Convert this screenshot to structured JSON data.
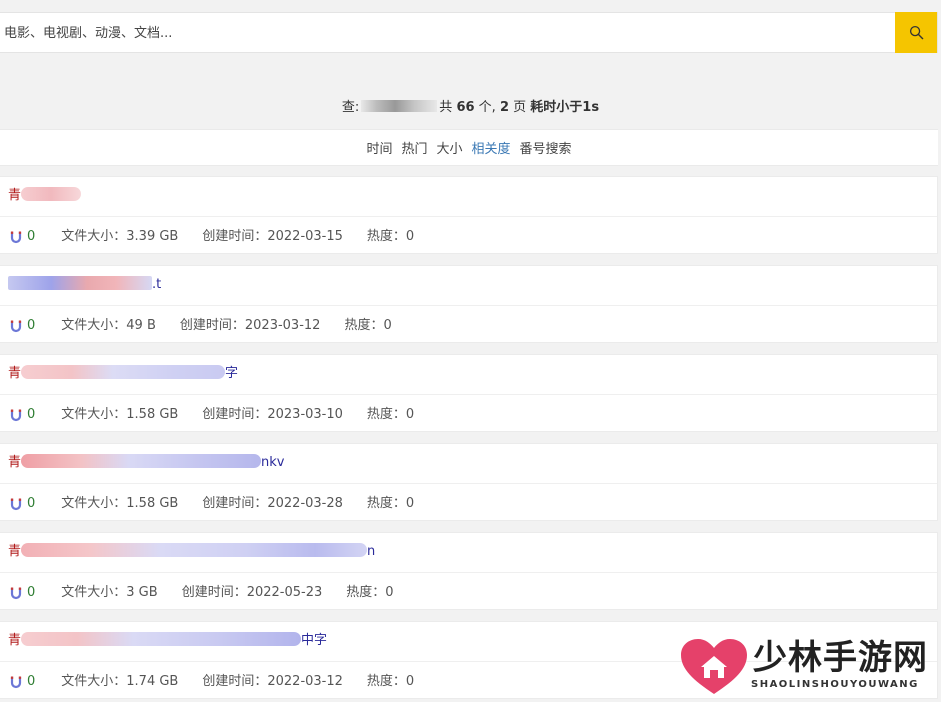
{
  "search": {
    "placeholder": "电影、电视剧、动漫、文档..."
  },
  "summary": {
    "prefix": "查:",
    "middle": "共",
    "count": "66",
    "count_unit": "个,",
    "pages": "2",
    "pages_unit": "页",
    "time_text": "耗时小于1s"
  },
  "sort": {
    "items": [
      "时间",
      "热门",
      "大小",
      "相关度",
      "番号搜索"
    ],
    "active_index": 3
  },
  "results": [
    {
      "title_start": "青",
      "title_end": "",
      "magnet": "0",
      "size": "文件大小：3.39 GB",
      "created": "创建时间：2022-03-15",
      "hot": "热度：0"
    },
    {
      "title_start": "",
      "title_end": ".t",
      "magnet": "0",
      "size": "文件大小：49 B",
      "created": "创建时间：2023-03-12",
      "hot": "热度：0"
    },
    {
      "title_start": "青",
      "title_end": "字",
      "magnet": "0",
      "size": "文件大小：1.58 GB",
      "created": "创建时间：2023-03-10",
      "hot": "热度：0"
    },
    {
      "title_start": "青",
      "title_end": "nkv",
      "magnet": "0",
      "size": "文件大小：1.58 GB",
      "created": "创建时间：2022-03-28",
      "hot": "热度：0"
    },
    {
      "title_start": "青",
      "title_end": "n",
      "magnet": "0",
      "size": "文件大小：3 GB",
      "created": "创建时间：2022-05-23",
      "hot": "热度：0"
    },
    {
      "title_start": "青",
      "title_end": "中字",
      "magnet": "0",
      "size": "文件大小：1.74 GB",
      "created": "创建时间：2022-03-12",
      "hot": "热度：0"
    }
  ],
  "watermark": {
    "name": "少林手游网",
    "sub": "SHAOLINSHOUYOUWANG"
  },
  "colors": {
    "accent": "#f5c500",
    "link": "#2a2a9a",
    "active_sort": "#3a78b4",
    "title_red": "#b01818"
  }
}
